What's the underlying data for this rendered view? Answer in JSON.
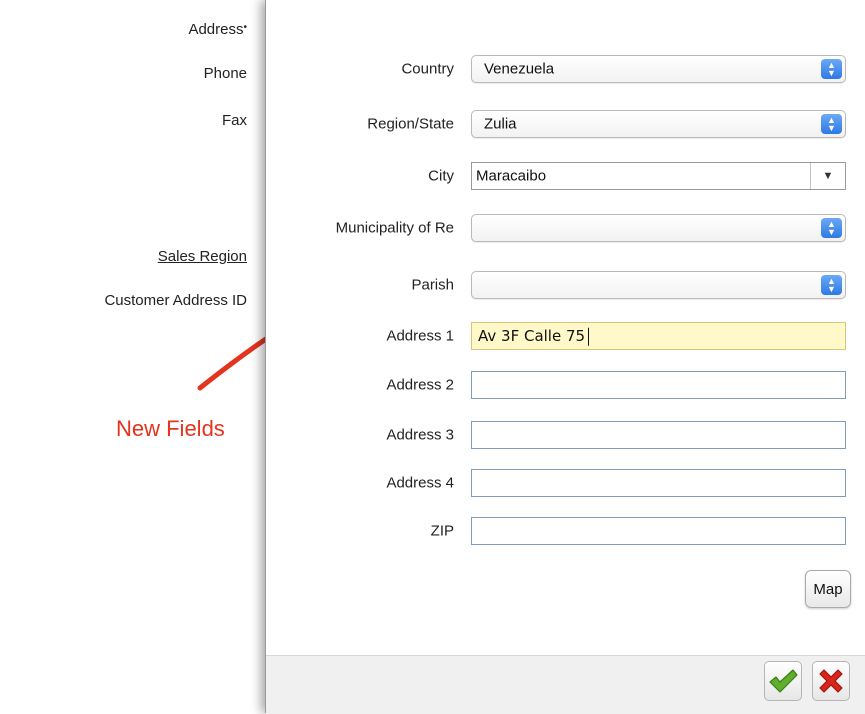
{
  "background_form": {
    "address_label": "Address",
    "address_required_mark": "•",
    "phone_label": "Phone",
    "fax_label": "Fax",
    "sales_region_label": "Sales Region",
    "customer_address_id_label": "Customer Address ID"
  },
  "dialog": {
    "country": {
      "label": "Country",
      "value": "Venezuela"
    },
    "region": {
      "label": "Region/State",
      "value": "Zulia"
    },
    "city": {
      "label": "City",
      "value": "Maracaibo"
    },
    "municipality": {
      "label": "Municipality of Re",
      "value": ""
    },
    "parish": {
      "label": "Parish",
      "value": ""
    },
    "address1": {
      "label": "Address 1",
      "value": "Av 3F Calle 75"
    },
    "address2": {
      "label": "Address 2",
      "value": ""
    },
    "address3": {
      "label": "Address 3",
      "value": ""
    },
    "address4": {
      "label": "Address 4",
      "value": ""
    },
    "zip": {
      "label": "ZIP",
      "value": ""
    },
    "map_button": "Map",
    "ok_icon": "green-checkmark-icon",
    "cancel_icon": "red-x-icon"
  },
  "annotation": {
    "text": "New Fields",
    "color": "#e2341f"
  },
  "colors": {
    "stepper_blue": "#2e79e6",
    "focused_field": "#fff9c9",
    "ok_green": "#5fae2e",
    "cancel_red": "#d9261c"
  }
}
